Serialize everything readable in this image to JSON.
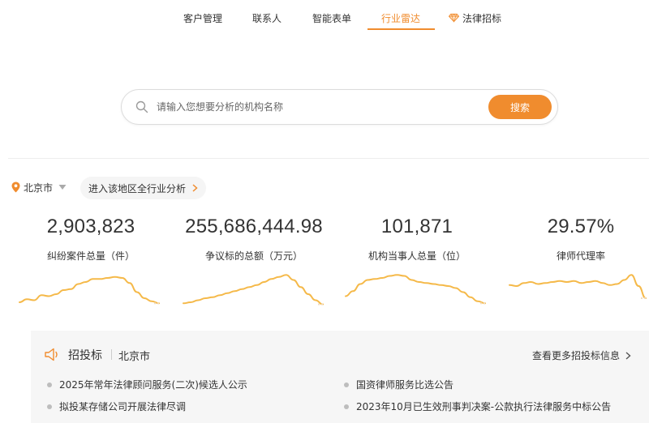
{
  "nav": {
    "items": [
      {
        "label": "客户管理"
      },
      {
        "label": "联系人"
      },
      {
        "label": "智能表单"
      },
      {
        "label": "行业雷达",
        "active": true
      },
      {
        "label": "法律招标",
        "icon": "gem-icon"
      }
    ]
  },
  "search": {
    "placeholder": "请输入您想要分析的机构名称",
    "value": "",
    "button_label": "搜索"
  },
  "region": {
    "city": "北京市",
    "analysis_link": "进入该地区全行业分析"
  },
  "stats": [
    {
      "value": "2,903,823",
      "label": "纠纷案件总量（件）",
      "trend": [
        4,
        7,
        6,
        11,
        10,
        12,
        16,
        17,
        22,
        24,
        27,
        27,
        28,
        29,
        28,
        23,
        14,
        8,
        5,
        3
      ]
    },
    {
      "value": "255,686,444.98",
      "label": "争议标的总额（万元）",
      "trend": [
        3,
        4,
        6,
        8,
        9,
        11,
        13,
        15,
        17,
        19,
        21,
        24,
        27,
        29,
        31,
        26,
        19,
        12,
        6,
        2
      ]
    },
    {
      "value": "101,871",
      "label": "机构当事人总量（位）",
      "trend": [
        10,
        15,
        22,
        26,
        27,
        28,
        30,
        31,
        30,
        26,
        24,
        23,
        22,
        21,
        20,
        18,
        14,
        9,
        5,
        3
      ]
    },
    {
      "value": "29.57%",
      "label": "律师代理率",
      "trend": [
        21,
        20,
        23,
        24,
        22,
        23,
        24,
        25,
        24,
        25,
        23,
        24,
        25,
        23,
        21,
        22,
        26,
        31,
        20,
        8
      ]
    }
  ],
  "bidding": {
    "title": "招投标",
    "city": "北京市",
    "more_label": "查看更多招投标信息",
    "items": [
      "2025年常年法律顾问服务(二次)候选人公示",
      "国资律师服务比选公告",
      "拟投某存储公司开展法律尽调",
      "2023年10月已生效刑事判决案-公款执行法律服务中标公告"
    ]
  },
  "colors": {
    "accent": "#f08c2e",
    "sparkline": "#f5b949",
    "panel_bg": "#f6f6f6"
  }
}
